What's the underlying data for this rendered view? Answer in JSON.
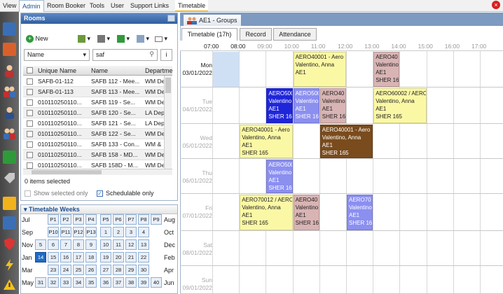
{
  "menu": {
    "items": [
      "View",
      "Admin",
      "Room Booker",
      "Tools",
      "User",
      "Support Links",
      "Timetable"
    ]
  },
  "rooms": {
    "title": "Rooms",
    "new_label": "New",
    "filter_field": "Name",
    "search_value": "saf",
    "info_btn": "i",
    "columns": [
      "Unique Name",
      "Name",
      "Departme"
    ],
    "rows": [
      {
        "unique": "SAFB-01-112",
        "name": "SAFB 112 - Mee...",
        "dept": "WM De"
      },
      {
        "unique": "SAFB-01-113",
        "name": "SAFB 113 - Mee...",
        "dept": "WM De"
      },
      {
        "unique": "010110250110...",
        "name": "SAFB 119 - Se...",
        "dept": "WM De"
      },
      {
        "unique": "010110250110...",
        "name": "SAFB 120 - Se...",
        "dept": "LA Dep"
      },
      {
        "unique": "010110250110...",
        "name": "SAFB 121 - Se...",
        "dept": "LA Dep"
      },
      {
        "unique": "010110250110...",
        "name": "SAFB 122 - Se...",
        "dept": "WM De"
      },
      {
        "unique": "010110250110...",
        "name": "SAFB 133 - Con...",
        "dept": "WM &"
      },
      {
        "unique": "010110250110...",
        "name": "SAFB 158 - MD...",
        "dept": "WM De"
      },
      {
        "unique": "010110250110...",
        "name": "SAFB 158D - M...",
        "dept": "WM De"
      }
    ],
    "status": "0 items selected",
    "show_selected": "Show selected only",
    "schedulable": "Schedulable only"
  },
  "weeks": {
    "title": "Timetable Weeks",
    "left_months": [
      "Jul",
      "Sep",
      "Nov",
      "Jan",
      "Mar",
      "May"
    ],
    "right_months": [
      "Aug",
      "Oct",
      "Dec",
      "Feb",
      "Apr",
      "Jun"
    ],
    "rows": [
      [
        "",
        "P1",
        "P2",
        "P3",
        "P4",
        "",
        "P5",
        "P6",
        "P7",
        "P8",
        "P9"
      ],
      [
        "",
        "P10",
        "P11",
        "P12",
        "P13",
        "",
        "1",
        "2",
        "3",
        "4",
        ""
      ],
      [
        "5",
        "6",
        "7",
        "8",
        "9",
        "",
        "10",
        "11",
        "12",
        "13",
        ""
      ],
      [
        "14",
        "15",
        "16",
        "17",
        "18",
        "",
        "19",
        "20",
        "21",
        "22",
        ""
      ],
      [
        "",
        "23",
        "24",
        "25",
        "26",
        "",
        "27",
        "28",
        "29",
        "30",
        ""
      ],
      [
        "31",
        "32",
        "33",
        "34",
        "35",
        "",
        "36",
        "37",
        "38",
        "39",
        "40"
      ]
    ],
    "selected": "14"
  },
  "timetable": {
    "tab_title": "AE1 - Groups",
    "subtabs": [
      "Timetable (17h)",
      "Record",
      "Attendance"
    ],
    "times": [
      "07:00",
      "08:00",
      "09:00",
      "10:00",
      "11:00",
      "12:00",
      "13:00",
      "14:00",
      "15:00",
      "16:00",
      "17:00"
    ],
    "days": [
      {
        "day": "Mon",
        "date": "03/01/2022"
      },
      {
        "day": "Tue",
        "date": "04/01/2022"
      },
      {
        "day": "Wed",
        "date": "05/01/2022"
      },
      {
        "day": "Thu",
        "date": "06/01/2022"
      },
      {
        "day": "Fri",
        "date": "07/01/2022"
      },
      {
        "day": "Sat",
        "date": "08/01/2022"
      },
      {
        "day": "Sun",
        "date": "09/01/2022"
      }
    ],
    "events": [
      {
        "l1": "AERO40001 - Aero",
        "l2": "Valentino, Anna",
        "l3": "AE1",
        "l4": "",
        "color": "#fbf8a5",
        "text": "#222"
      },
      {
        "l1": "AERO40",
        "l2": "Valentino",
        "l3": "AE1",
        "l4": "SHER 16",
        "color": "#d9b4b4",
        "text": "#222"
      },
      {
        "l1": "AERO500",
        "l2": "Valentino",
        "l3": "AE1",
        "l4": "SHER 16",
        "color": "#1f26d9",
        "text": "#fff"
      },
      {
        "l1": "AERO500",
        "l2": "Valentino",
        "l3": "AE1",
        "l4": "SHER 16",
        "color": "#8b8ff0",
        "text": "#fff"
      },
      {
        "l1": "AERO40",
        "l2": "Valentino",
        "l3": "AE1",
        "l4": "SHER 16",
        "color": "#d9b4b4",
        "text": "#222"
      },
      {
        "l1": "AERO60002 / AERO",
        "l2": "Valentino, Anna",
        "l3": "AE1",
        "l4": "SHER 165",
        "color": "#fbf8a5",
        "text": "#222"
      },
      {
        "l1": "AERO40001 - Aero",
        "l2": "Valentino, Anna",
        "l3": "AE1",
        "l4": "SHER 165",
        "color": "#fbf8a5",
        "text": "#222"
      },
      {
        "l1": "AERO40001 - Aero",
        "l2": "Valentino, Anna",
        "l3": "AE1",
        "l4": "SHER 165",
        "color": "#7a4b1c",
        "text": "#fff"
      },
      {
        "l1": "AERO500",
        "l2": "Valentino",
        "l3": "AE1",
        "l4": "SHER 16",
        "color": "#8b8ff0",
        "text": "#fff"
      },
      {
        "l1": "AERO70012 / AERO",
        "l2": "Valentino, Anna",
        "l3": "AE1",
        "l4": "SHER 165",
        "color": "#fbf8a5",
        "text": "#222"
      },
      {
        "l1": "AERO40",
        "l2": "Valentino",
        "l3": "AE1",
        "l4": "SHER 16",
        "color": "#d9b4b4",
        "text": "#222"
      },
      {
        "l1": "AERO70",
        "l2": "Valentino",
        "l3": "AE1",
        "l4": "SHER 16",
        "color": "#8b8ff0",
        "text": "#fff"
      }
    ]
  }
}
